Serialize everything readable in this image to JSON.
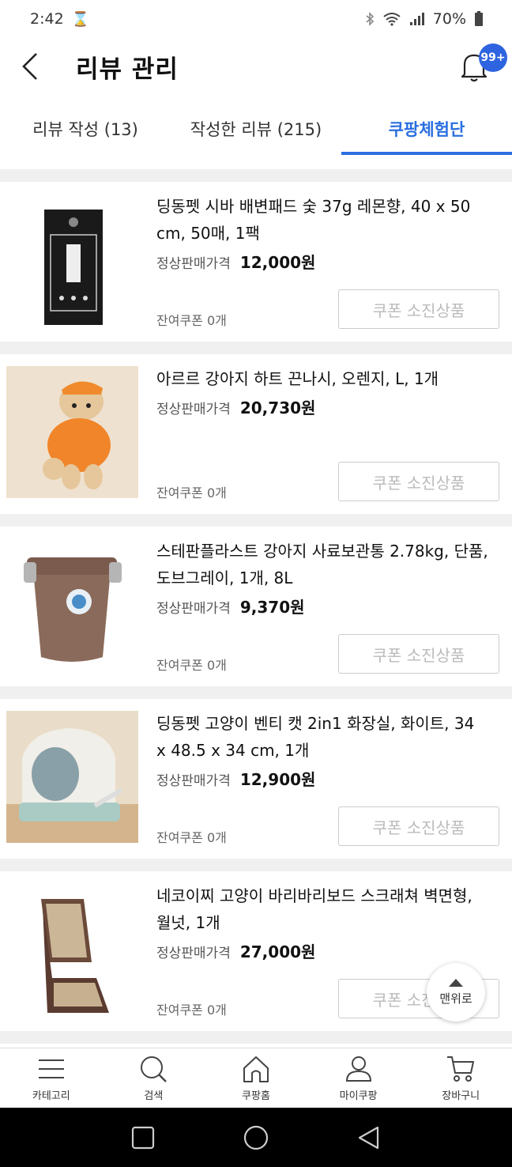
{
  "status": {
    "time": "2:42",
    "battery": "70%"
  },
  "header": {
    "title": "리뷰 관리",
    "badge": "99+"
  },
  "tabs": [
    {
      "label": "리뷰 작성 (13)"
    },
    {
      "label": "작성한 리뷰 (215)"
    },
    {
      "label": "쿠팡체험단"
    }
  ],
  "items": [
    {
      "title": "딩동펫 시바 배변패드 숯 37g 레몬향, 40 x 50 cm, 50매, 1팩",
      "price_label": "정상판매가격",
      "price": "12,000원",
      "coupon": "잔여쿠폰 0개",
      "button": "쿠폰 소진상품"
    },
    {
      "title": "아르르 강아지 하트 끈나시, 오렌지, L, 1개",
      "price_label": "정상판매가격",
      "price": "20,730원",
      "coupon": "잔여쿠폰 0개",
      "button": "쿠폰 소진상품"
    },
    {
      "title": "스테판플라스트 강아지 사료보관통 2.78kg, 단품, 도브그레이, 1개, 8L",
      "price_label": "정상판매가격",
      "price": "9,370원",
      "coupon": "잔여쿠폰 0개",
      "button": "쿠폰 소진상품"
    },
    {
      "title": "딩동펫 고양이 벤티 캣 2in1 화장실, 화이트, 34 x 48.5 x 34 cm, 1개",
      "price_label": "정상판매가격",
      "price": "12,900원",
      "coupon": "잔여쿠폰 0개",
      "button": "쿠폰 소진상품"
    },
    {
      "title": "네코이찌 고양이 바리바리보드 스크래쳐 벽면형, 월넛, 1개",
      "price_label": "정상판매가격",
      "price": "27,000원",
      "coupon": "잔여쿠폰 0개",
      "button": "쿠폰 소진상품"
    }
  ],
  "to_top": "맨위로",
  "bottom_nav": [
    {
      "label": "카테고리",
      "icon": "menu-icon"
    },
    {
      "label": "검색",
      "icon": "search-icon"
    },
    {
      "label": "쿠팡홈",
      "icon": "home-icon"
    },
    {
      "label": "마이쿠팡",
      "icon": "person-icon"
    },
    {
      "label": "장바구니",
      "icon": "cart-icon"
    }
  ],
  "colors": {
    "accent": "#2a6fe0",
    "badge": "#2f64e0"
  }
}
